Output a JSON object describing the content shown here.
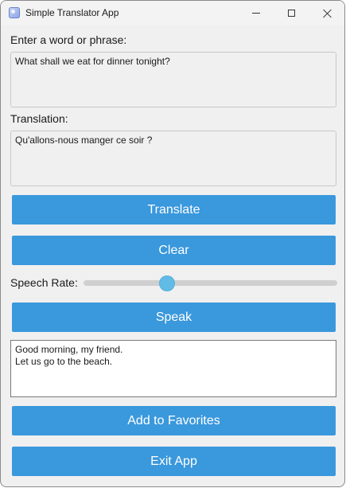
{
  "window": {
    "title": "Simple Translator App",
    "icon": "translator-app-icon",
    "controls": [
      "minimize-icon",
      "maximize-icon",
      "close-icon"
    ]
  },
  "input": {
    "label": "Enter a word or phrase:",
    "value": "What shall we eat for dinner tonight?"
  },
  "translation": {
    "label": "Translation:",
    "value": "Qu'allons-nous manger ce soir ?"
  },
  "buttons": {
    "translate": "Translate",
    "clear": "Clear",
    "speak": "Speak",
    "add_favorites": "Add to Favorites",
    "exit": "Exit App"
  },
  "speech_rate": {
    "label": "Speech Rate:",
    "value_fraction": 0.32
  },
  "favorites": {
    "text": "Good morning, my friend.\nLet us go to the beach."
  },
  "colors": {
    "button": "#3a98dc",
    "slider_thumb": "#62bbe5",
    "slider_track": "#cfcfcf",
    "window_bg": "#f0f0f0"
  }
}
